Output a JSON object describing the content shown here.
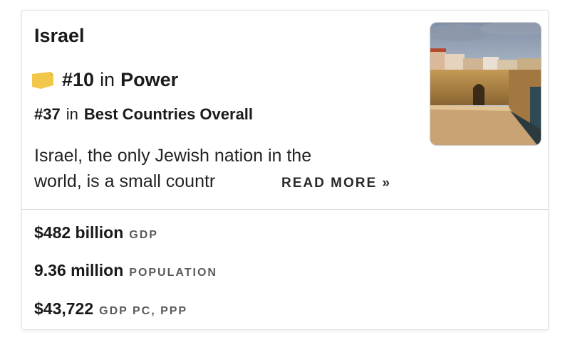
{
  "country": {
    "name": "Israel"
  },
  "ranks": {
    "power": {
      "number": "#10",
      "in": "in",
      "category": "Power"
    },
    "overall": {
      "number": "#37",
      "in": "in",
      "category": "Best Countries Overall"
    }
  },
  "description": {
    "line1": "Israel, the only Jewish nation in the",
    "line2": "world, is a small countr",
    "read_more": "READ MORE »"
  },
  "stats": [
    {
      "value": "$482 billion",
      "label": "GDP"
    },
    {
      "value": "9.36 million",
      "label": "POPULATION"
    },
    {
      "value": "$43,722",
      "label": "GDP PC, PPP"
    }
  ],
  "colors": {
    "badge": "#f2c84b",
    "badge_shade": "#e0b233"
  },
  "icons": {
    "rank_badge": "ribbon-badge-icon"
  }
}
